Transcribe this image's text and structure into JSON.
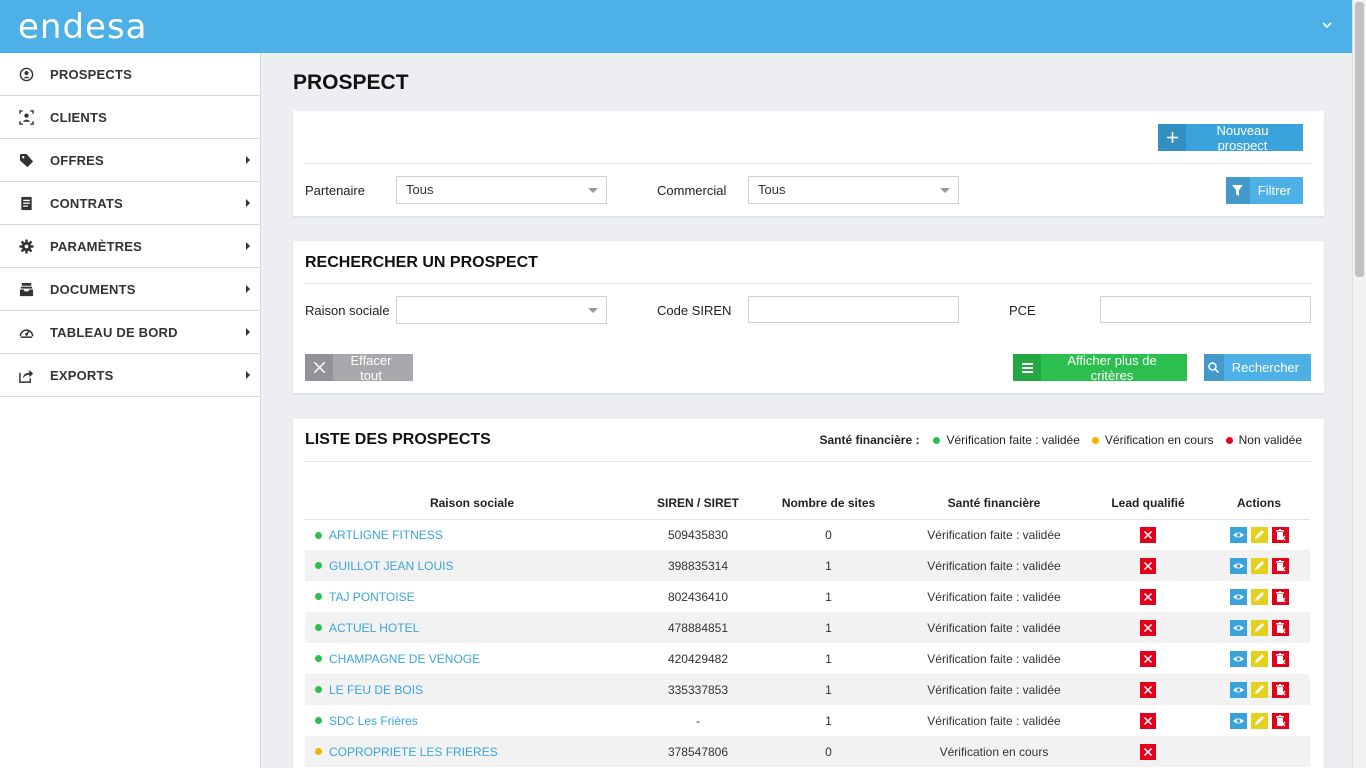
{
  "header": {
    "logo_text": "endesa",
    "user_menu_icon": "chevron-down-icon"
  },
  "sidebar": {
    "items": [
      {
        "label": "PROSPECTS",
        "icon": "user-circle-icon",
        "has_submenu": false
      },
      {
        "label": "CLIENTS",
        "icon": "user-frame-icon",
        "has_submenu": false
      },
      {
        "label": "OFFRES",
        "icon": "tag-icon",
        "has_submenu": true
      },
      {
        "label": "CONTRATS",
        "icon": "document-icon",
        "has_submenu": true
      },
      {
        "label": "PARAMÈTRES",
        "icon": "gear-icon",
        "has_submenu": true
      },
      {
        "label": "DOCUMENTS",
        "icon": "inbox-icon",
        "has_submenu": true
      },
      {
        "label": "TABLEAU DE BORD",
        "icon": "dashboard-icon",
        "has_submenu": true
      },
      {
        "label": "EXPORTS",
        "icon": "export-icon",
        "has_submenu": true
      }
    ]
  },
  "page": {
    "title": "PROSPECT"
  },
  "filter_card": {
    "new_button": "Nouveau prospect",
    "partner_label": "Partenaire",
    "partner_value": "Tous",
    "commercial_label": "Commercial",
    "commercial_value": "Tous",
    "filter_button": "Filtrer"
  },
  "search_card": {
    "title": "RECHERCHER UN PROSPECT",
    "raison_label": "Raison sociale",
    "raison_value": "",
    "siren_label": "Code SIREN",
    "siren_placeholder": "",
    "pce_label": "PCE",
    "pce_placeholder": "",
    "clear_button": "Effacer tout",
    "more_button": "Afficher plus de critères",
    "search_button": "Rechercher"
  },
  "list_card": {
    "title": "LISTE DES PROSPECTS",
    "legend_title": "Santé financière :",
    "legend": [
      {
        "label": "Vérification faite : validée",
        "color": "#2bbf4e"
      },
      {
        "label": "Vérification en cours",
        "color": "#f0b400"
      },
      {
        "label": "Non validée",
        "color": "#e3001b"
      }
    ],
    "columns": [
      "Raison sociale",
      "SIREN / SIRET",
      "Nombre de sites",
      "Santé financière",
      "Lead qualifié",
      "Actions"
    ],
    "rows": [
      {
        "name": "ARTLIGNE FITNESS",
        "siren": "509435830",
        "sites": "0",
        "sante": "Vérification faite : validée",
        "status_color": "#2bbf4e",
        "actions": true
      },
      {
        "name": "GUILLOT JEAN LOUIS",
        "siren": "398835314",
        "sites": "1",
        "sante": "Vérification faite : validée",
        "status_color": "#2bbf4e",
        "actions": true
      },
      {
        "name": "TAJ PONTOISE",
        "siren": "802436410",
        "sites": "1",
        "sante": "Vérification faite : validée",
        "status_color": "#2bbf4e",
        "actions": true
      },
      {
        "name": "ACTUEL HOTEL",
        "siren": "478884851",
        "sites": "1",
        "sante": "Vérification faite : validée",
        "status_color": "#2bbf4e",
        "actions": true
      },
      {
        "name": "CHAMPAGNE DE VENOGE",
        "siren": "420429482",
        "sites": "1",
        "sante": "Vérification faite : validée",
        "status_color": "#2bbf4e",
        "actions": true
      },
      {
        "name": "LE FEU DE BOIS",
        "siren": "335337853",
        "sites": "1",
        "sante": "Vérification faite : validée",
        "status_color": "#2bbf4e",
        "actions": true
      },
      {
        "name": "SDC Les Frières",
        "siren": "-",
        "sites": "1",
        "sante": "Vérification faite : validée",
        "status_color": "#2bbf4e",
        "actions": true
      },
      {
        "name": "COPROPRIETE LES FRIERES",
        "siren": "378547806",
        "sites": "0",
        "sante": "Vérification en cours",
        "status_color": "#f0b400",
        "actions": false
      }
    ]
  },
  "colors": {
    "accent": "#4db0e6",
    "green_button": "#2bbf4e",
    "link": "#3aa3dc",
    "danger": "#e3001b",
    "edit": "#e6d01e"
  }
}
